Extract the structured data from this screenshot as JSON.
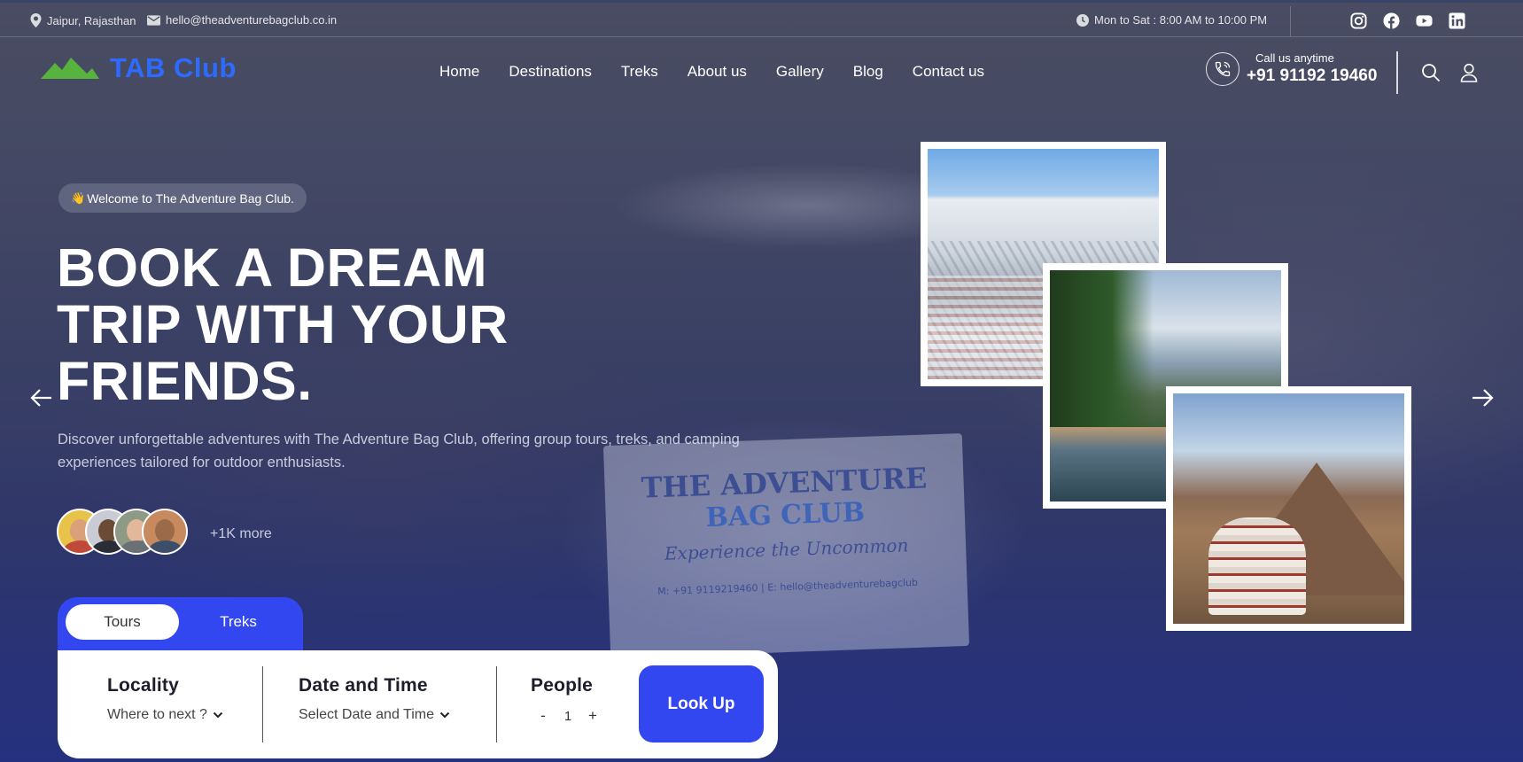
{
  "topbar": {
    "location": "Jaipur, Rajasthan",
    "email": "hello@theadventurebagclub.co.in",
    "hours": "Mon to Sat : 8:00 AM to 10:00 PM",
    "socials": [
      "instagram-icon",
      "facebook-icon",
      "youtube-icon",
      "linkedin-icon"
    ]
  },
  "header": {
    "logo_text": "TAB Club",
    "nav": [
      "Home",
      "Destinations",
      "Treks",
      "About us",
      "Gallery",
      "Blog",
      "Contact us"
    ],
    "call_label": "Call us anytime",
    "call_number": "+91 91192 19460"
  },
  "hero": {
    "welcome": "Welcome to The Adventure Bag Club.",
    "welcome_emoji": "👋",
    "title": "BOOK A DREAM TRIP WITH YOUR FRIENDS.",
    "description": "Discover unforgettable adventures with The Adventure Bag Club, offering group tours, treks, and camping experiences tailored for outdoor enthusiasts.",
    "more": "+1K more",
    "banner": {
      "line1": "THE ADVENTURE",
      "line2": "BAG CLUB",
      "line3": "Experience the Uncommon",
      "line4": "M: +91 9119219460 | E: hello@theadventurebagclub"
    }
  },
  "booking": {
    "tabs": [
      "Tours",
      "Treks"
    ],
    "active_tab": "Tours",
    "locality_label": "Locality",
    "locality_value": "Where to next ?",
    "date_label": "Date and Time",
    "date_value": "Select Date and Time",
    "people_label": "People",
    "people_minus": "-",
    "people_count": "1",
    "people_plus": "+",
    "button": "Look Up"
  },
  "colors": {
    "accent": "#3347f0",
    "logo": "#2d6bff",
    "logo_mountain": "#57b33e"
  }
}
